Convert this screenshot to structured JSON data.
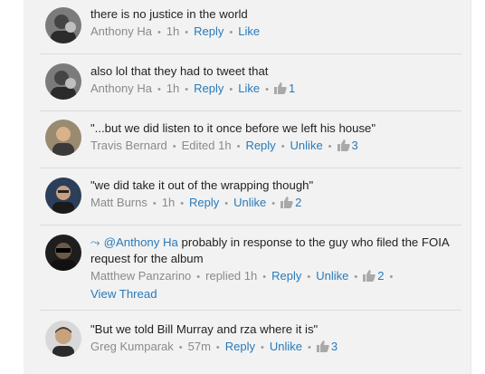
{
  "comments": [
    {
      "text": "there is no justice in the world",
      "author": "Anthony Ha",
      "time": "1h",
      "reply_label": "Reply",
      "like_label": "Like",
      "likes": ""
    },
    {
      "text": "also lol that they had to tweet that",
      "author": "Anthony Ha",
      "time": "1h",
      "reply_label": "Reply",
      "like_label": "Like",
      "likes": "1"
    },
    {
      "text": "\"...but we did listen to it once before we left his house\"",
      "author": "Travis Bernard",
      "time": "Edited 1h",
      "reply_label": "Reply",
      "like_label": "Unlike",
      "likes": "3"
    },
    {
      "text": "\"we did take it out of the wrapping though\"",
      "author": "Matt Burns",
      "time": "1h",
      "reply_label": "Reply",
      "like_label": "Unlike",
      "likes": "2"
    },
    {
      "mention": "@Anthony Ha",
      "text": " probably in response to the guy who filed the FOIA request for the album",
      "author": "Matthew Panzarino",
      "time": "replied 1h",
      "reply_label": "Reply",
      "like_label": "Unlike",
      "likes": "2",
      "view_thread_label": "View Thread"
    },
    {
      "text": "\"But we told Bill Murray and rza where it is\"",
      "author": "Greg Kumparak",
      "time": "57m",
      "reply_label": "Reply",
      "like_label": "Unlike",
      "likes": "3"
    }
  ],
  "colors": {
    "link": "#2a7ab8",
    "meta": "#8a8a8a",
    "panel": "#f2f2f2"
  }
}
